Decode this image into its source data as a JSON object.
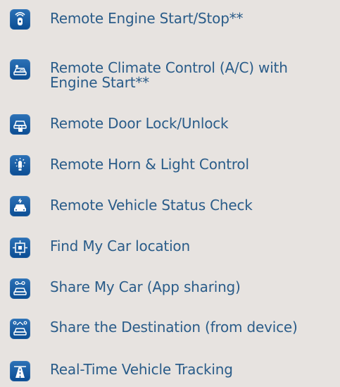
{
  "features": [
    {
      "label": "Remote Engine Start/Stop**",
      "icon": "remote-key-fob-icon"
    },
    {
      "label": "Remote Climate Control (A/C) with",
      "label_line2": "Engine Start**",
      "icon": "climate-car-icon"
    },
    {
      "label": "Remote Door Lock/Unlock",
      "icon": "door-lock-icon"
    },
    {
      "label": "Remote Horn & Light Control",
      "icon": "horn-light-icon"
    },
    {
      "label": "Remote Vehicle Status Check",
      "icon": "vehicle-status-icon"
    },
    {
      "label": "Find My Car location",
      "icon": "find-car-icon"
    },
    {
      "label": "Share My Car (App sharing)",
      "icon": "share-car-icon"
    },
    {
      "label": "Share the Destination (from device)",
      "icon": "share-destination-icon"
    },
    {
      "label": "Real-Time Vehicle Tracking",
      "icon": "vehicle-tracking-icon"
    }
  ],
  "colors": {
    "background": "#e7e3e0",
    "text": "#2a5c89",
    "icon_tile": "#0b4d93"
  }
}
